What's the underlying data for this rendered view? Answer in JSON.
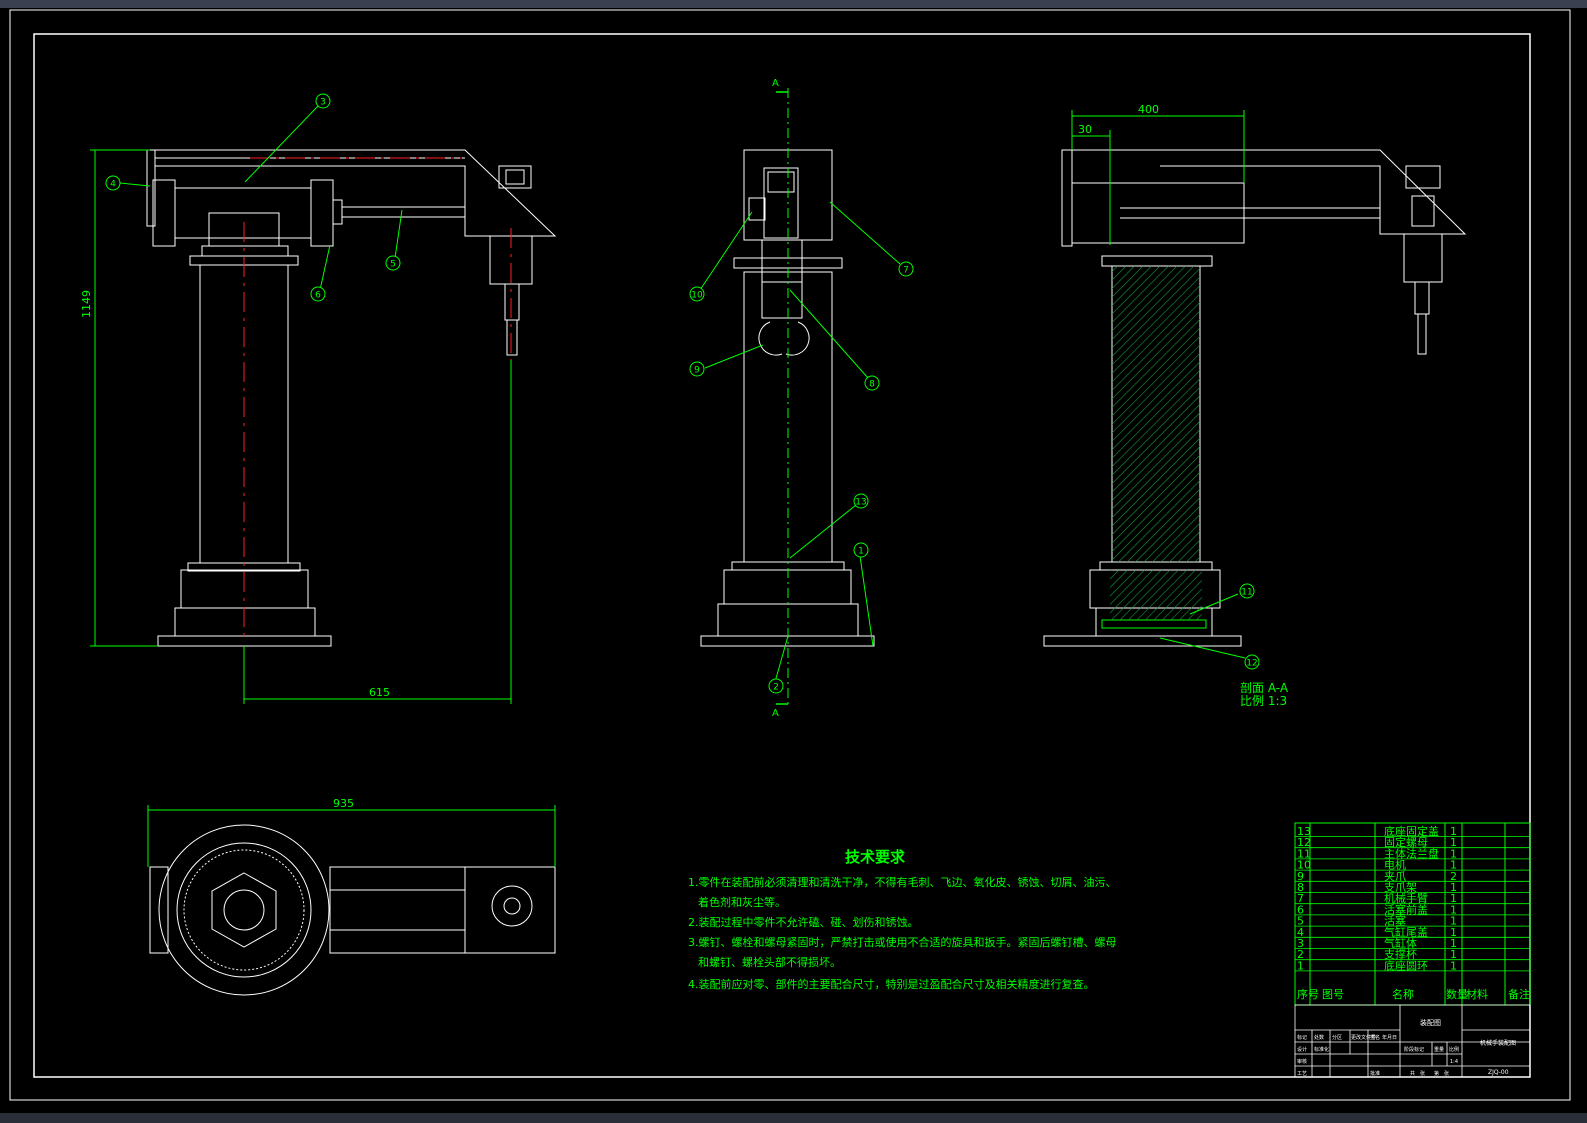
{
  "colors": {
    "line": "#ffffff",
    "green": "#00ff00",
    "red": "#ff2020",
    "hatch": "#1a7a2a",
    "bg": "#000000"
  },
  "dims": {
    "width": "615",
    "height": "1149",
    "top_width": "935",
    "sec_width": "400",
    "sec_small": "30"
  },
  "section_marks": {
    "top": "A",
    "bottom": "A"
  },
  "balloons": [
    "1",
    "2",
    "3",
    "4",
    "5",
    "6",
    "7",
    "8",
    "9",
    "10",
    "11",
    "12",
    "13"
  ],
  "section_label": {
    "line1": "剖面 A-A",
    "line2": "比例 1:3"
  },
  "tech": {
    "title": "技术要求",
    "lines": [
      "1.零件在装配前必须清理和清洗干净，不得有毛刺、飞边、氧化皮、锈蚀、切屑、油污、",
      "着色剂和灰尘等。",
      "2.装配过程中零件不允许磕、碰、划伤和锈蚀。",
      "3.螺钉、螺栓和螺母紧固时，严禁打击或使用不合适的旋具和扳手。紧固后螺钉槽、螺母",
      "和螺钉、螺栓头部不得损坏。",
      "4.装配前应对零、部件的主要配合尺寸，特别是过盈配合尺寸及相关精度进行复查。"
    ]
  },
  "bom": {
    "rows": [
      {
        "no": "13",
        "name": "底座固定盖",
        "qty": "1"
      },
      {
        "no": "12",
        "name": "固定螺母",
        "qty": "1"
      },
      {
        "no": "11",
        "name": "主体法兰盘",
        "qty": "1"
      },
      {
        "no": "10",
        "name": "电机",
        "qty": "1"
      },
      {
        "no": "9",
        "name": "夹爪",
        "qty": "2"
      },
      {
        "no": "8",
        "name": "支爪架",
        "qty": "1"
      },
      {
        "no": "7",
        "name": "机械手臂",
        "qty": "1"
      },
      {
        "no": "6",
        "name": "活塞前盖",
        "qty": "1"
      },
      {
        "no": "5",
        "name": "活塞",
        "qty": "1"
      },
      {
        "no": "4",
        "name": "气缸尾盖",
        "qty": "1"
      },
      {
        "no": "3",
        "name": "气缸体",
        "qty": "1"
      },
      {
        "no": "2",
        "name": "支撑杯",
        "qty": "1"
      },
      {
        "no": "1",
        "name": "底座圆环",
        "qty": "1"
      }
    ],
    "header": {
      "no": "序号",
      "code": "图号",
      "name": "名称",
      "qty": "数量",
      "mat": "材料",
      "note": "备注"
    }
  },
  "title_block": {
    "material": "装配图",
    "drawing_title": "机械手装配图",
    "code": "ZJQ-00",
    "cells": [
      "标记",
      "处数",
      "分区",
      "更改文件号",
      "签名",
      "年月日",
      "设计",
      "标准化",
      "阶段标记",
      "重量",
      "比例",
      "审核",
      "工艺",
      "批准",
      "共",
      "张",
      "第",
      "张"
    ],
    "scale": "1:4"
  }
}
